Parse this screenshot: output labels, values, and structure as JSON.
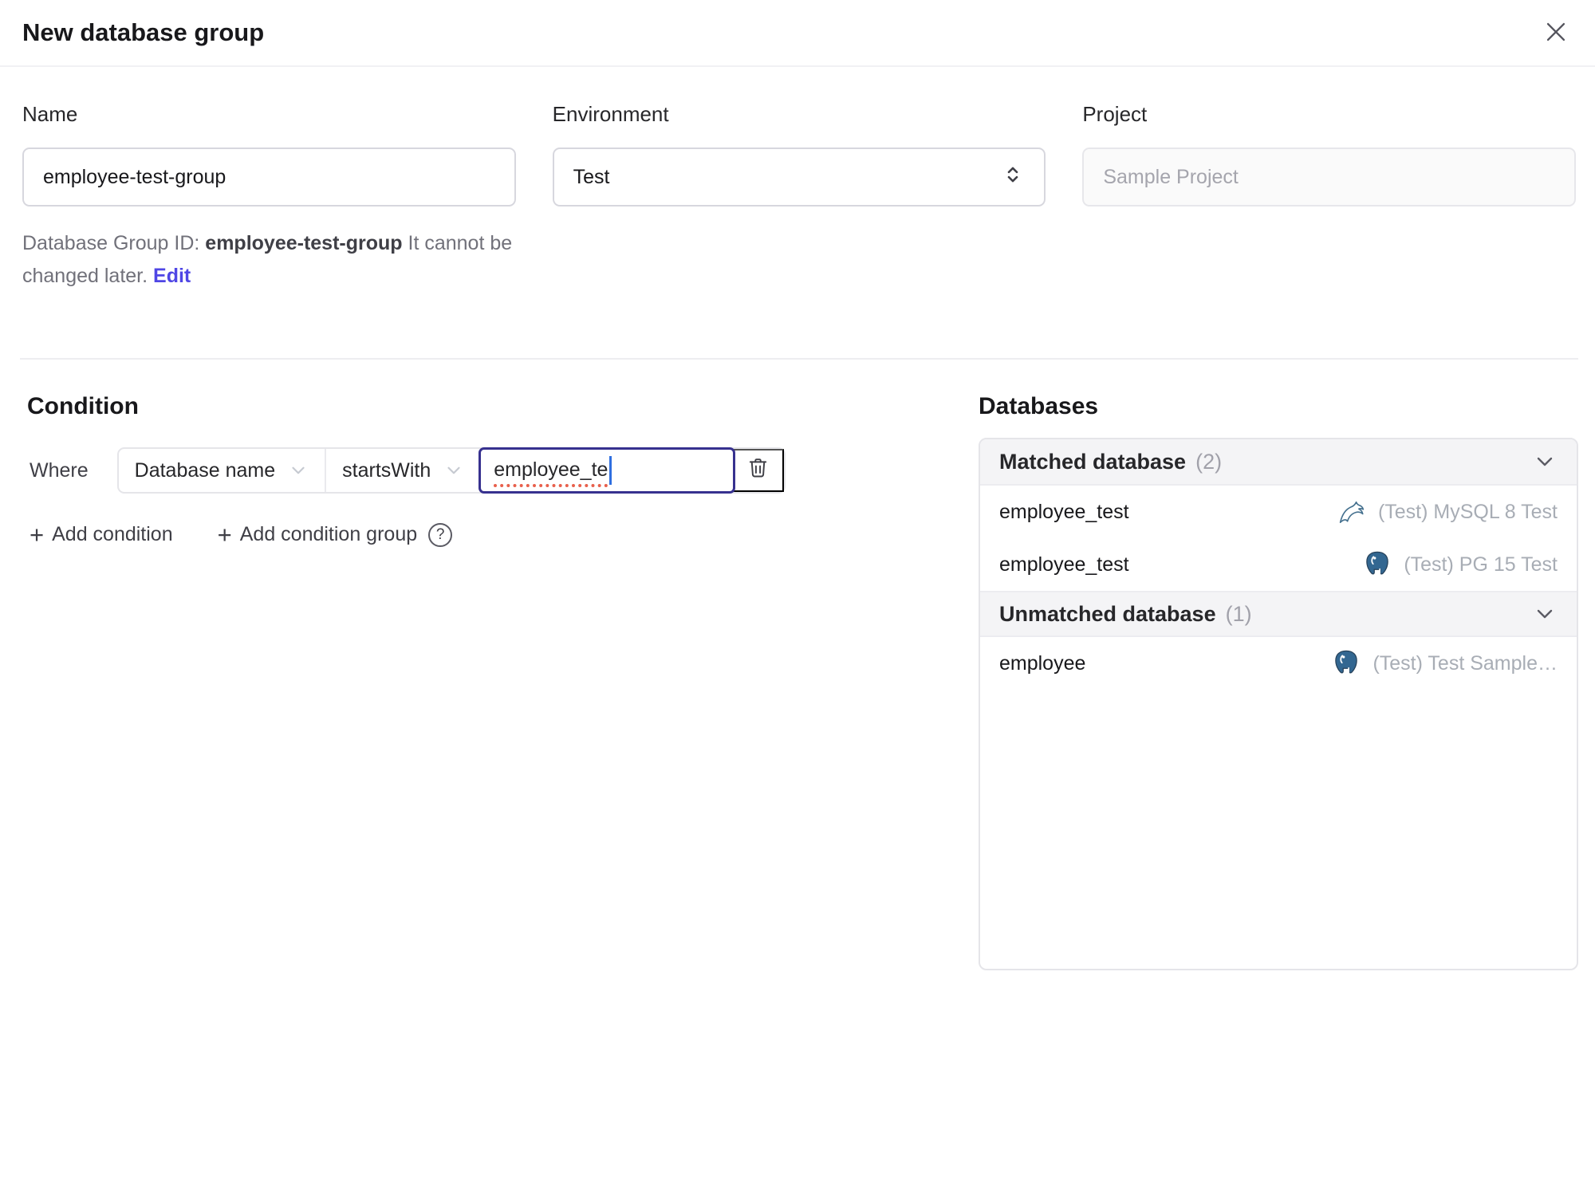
{
  "header": {
    "title": "New database group"
  },
  "form": {
    "name": {
      "label": "Name",
      "value": "employee-test-group"
    },
    "environment": {
      "label": "Environment",
      "value": "Test"
    },
    "project": {
      "label": "Project",
      "value": "Sample Project"
    },
    "id_hint": {
      "prefix": "Database Group ID: ",
      "id": "employee-test-group",
      "suffix": " It cannot be changed later. ",
      "edit_label": "Edit"
    }
  },
  "condition": {
    "heading": "Condition",
    "where_label": "Where",
    "field": "Database name",
    "operator": "startsWith",
    "value": "employee_te",
    "add_condition_label": "Add condition",
    "add_condition_group_label": "Add condition group",
    "help_glyph": "?"
  },
  "databases": {
    "heading": "Databases",
    "groups": [
      {
        "title": "Matched database",
        "count": "(2)",
        "rows": [
          {
            "name": "employee_test",
            "engine": "mysql",
            "instance": "(Test) MySQL 8 Test"
          },
          {
            "name": "employee_test",
            "engine": "postgresql",
            "instance": "(Test) PG 15 Test"
          }
        ]
      },
      {
        "title": "Unmatched database",
        "count": "(1)",
        "rows": [
          {
            "name": "employee",
            "engine": "postgresql",
            "instance": "(Test) Test Sample…"
          }
        ]
      }
    ]
  },
  "colors": {
    "accent": "#4f46e5",
    "focus_border": "#37318f",
    "caret": "#2f6fe0",
    "spellcheck": "#e8604c",
    "group_header_bg": "#f4f4f6",
    "muted_text": "#a8adb5",
    "mysql_icon": "#44708e",
    "postgres_icon": "#336791"
  }
}
